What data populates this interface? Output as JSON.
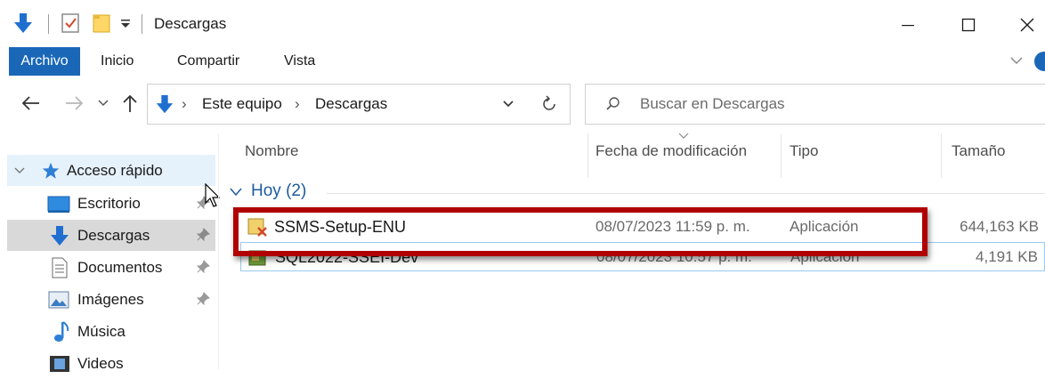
{
  "window": {
    "title": "Descargas",
    "controls": {
      "minimize": "—",
      "maximize": "☐",
      "close": "✕"
    }
  },
  "ribbon": {
    "tabs": [
      "Archivo",
      "Inicio",
      "Compartir",
      "Vista"
    ],
    "active_tab": "Archivo",
    "accent_color": "#1a67b8"
  },
  "address": {
    "breadcrumbs": [
      "Este equipo",
      "Descargas"
    ],
    "separator": "›",
    "search_placeholder": "Buscar en Descargas"
  },
  "nav": {
    "items": [
      {
        "label": "Acceso rápido",
        "icon": "star-icon"
      },
      {
        "label": "Escritorio",
        "icon": "desktop-icon",
        "pinned": true
      },
      {
        "label": "Descargas",
        "icon": "download-arrow-icon",
        "pinned": true
      },
      {
        "label": "Documentos",
        "icon": "document-icon",
        "pinned": true
      },
      {
        "label": "Imágenes",
        "icon": "pictures-icon",
        "pinned": true
      },
      {
        "label": "Música",
        "icon": "music-note-icon"
      },
      {
        "label": "Videos",
        "icon": "film-icon"
      }
    ]
  },
  "columns": [
    "Nombre",
    "Fecha de modificación",
    "Tipo",
    "Tamaño"
  ],
  "group": {
    "label": "Hoy (2)"
  },
  "files": [
    {
      "name": "SSMS-Setup-ENU",
      "date": "08/07/2023 11:59 p. m.",
      "type": "Aplicación",
      "size": "644,163 KB"
    },
    {
      "name": "SQL2022-SSEI-Dev",
      "date": "08/07/2023 10:57 p. m.",
      "type": "Aplicación",
      "size": "4,191 KB"
    }
  ],
  "annotation_color": "#b00000"
}
